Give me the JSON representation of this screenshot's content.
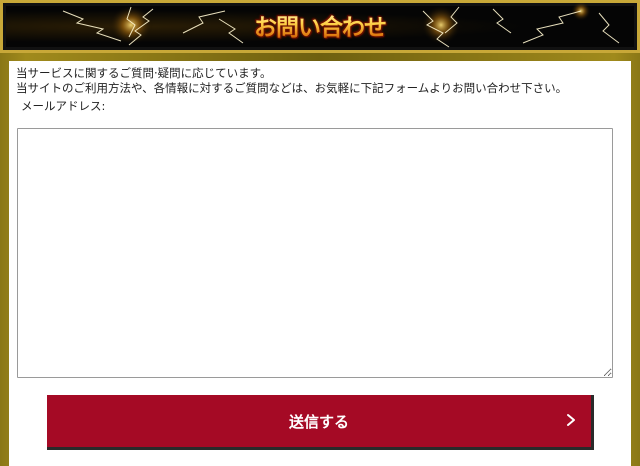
{
  "header": {
    "title": "お問い合わせ"
  },
  "form": {
    "intro_line1": "当サービスに関するご質問·疑問に応じています。",
    "intro_line2": "当サイトのご利用方法や、各情報に対するご質問などは、お気軽に下記フォームよりお問い合わせ下さい。",
    "email_label": "メールアドレス:",
    "message_value": "",
    "submit_label": "送信する"
  },
  "icons": {
    "submit_arrow": "chevron-right-icon",
    "header_decoration": "lightning-icon"
  },
  "colors": {
    "frame_gold": "#a08a1c",
    "header_bg": "#111111",
    "submit_bg": "#a50a25"
  }
}
